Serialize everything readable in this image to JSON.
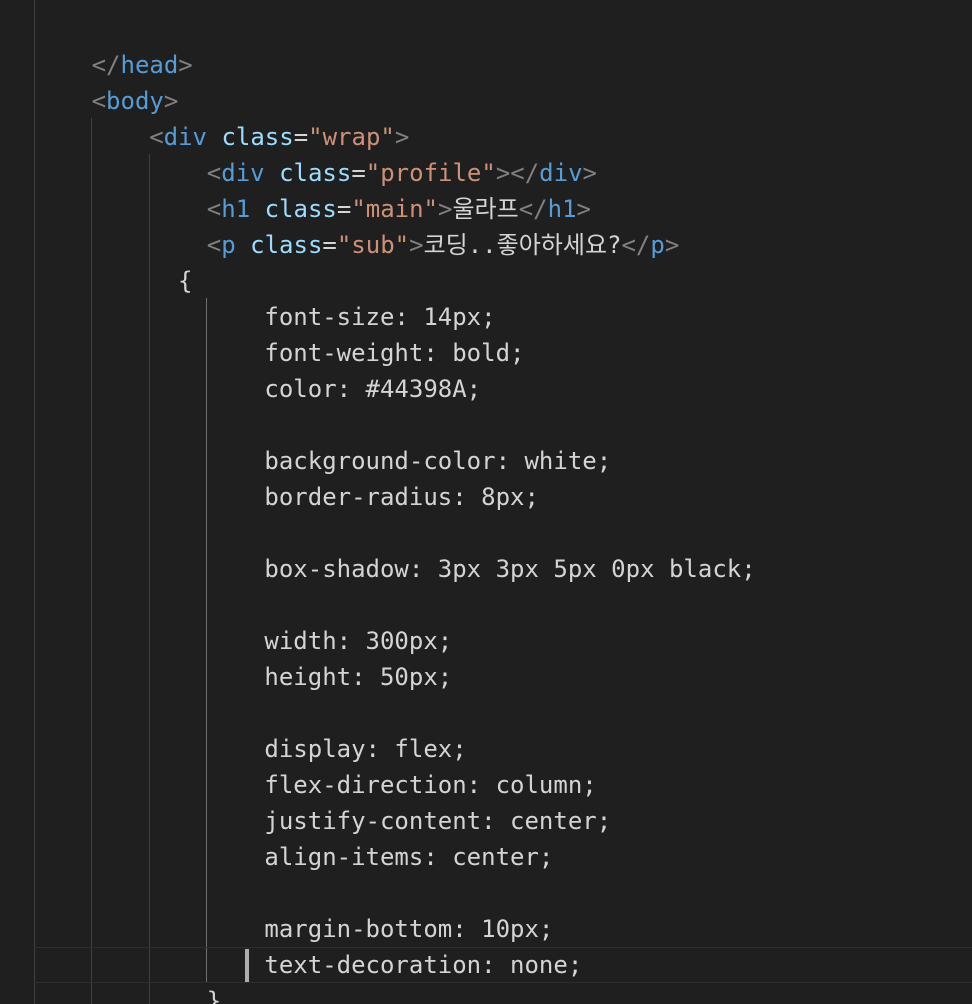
{
  "editor": {
    "lines": [
      {
        "indent": 1,
        "kind": "close",
        "tag": "head"
      },
      {
        "indent": 1,
        "kind": "open",
        "tag": "body"
      },
      {
        "indent": 2,
        "kind": "open",
        "tag": "div",
        "attr": "class",
        "value": "wrap"
      },
      {
        "indent": 3,
        "kind": "element",
        "tag": "div",
        "attr": "class",
        "value": "profile",
        "text": ""
      },
      {
        "indent": 3,
        "kind": "element",
        "tag": "h1",
        "attr": "class",
        "value": "main",
        "text": "울라프"
      },
      {
        "indent": 3,
        "kind": "element",
        "tag": "p",
        "attr": "class",
        "value": "sub",
        "text": "코딩..좋아하세요?"
      },
      {
        "indent": 2.5,
        "kind": "text",
        "text": "{"
      },
      {
        "indent": 4,
        "kind": "text",
        "text": "font-size: 14px;"
      },
      {
        "indent": 4,
        "kind": "text",
        "text": "font-weight: bold;"
      },
      {
        "indent": 4,
        "kind": "text",
        "text": "color: #44398A;"
      },
      {
        "indent": 4,
        "kind": "blank",
        "text": ""
      },
      {
        "indent": 4,
        "kind": "text",
        "text": "background-color: white;"
      },
      {
        "indent": 4,
        "kind": "text",
        "text": "border-radius: 8px;"
      },
      {
        "indent": 4,
        "kind": "blank",
        "text": ""
      },
      {
        "indent": 4,
        "kind": "text",
        "text": "box-shadow: 3px 3px 5px 0px black;"
      },
      {
        "indent": 4,
        "kind": "blank",
        "text": ""
      },
      {
        "indent": 4,
        "kind": "text",
        "text": "width: 300px;"
      },
      {
        "indent": 4,
        "kind": "text",
        "text": "height: 50px;"
      },
      {
        "indent": 4,
        "kind": "blank",
        "text": ""
      },
      {
        "indent": 4,
        "kind": "text",
        "text": "display: flex;"
      },
      {
        "indent": 4,
        "kind": "text",
        "text": "flex-direction: column;"
      },
      {
        "indent": 4,
        "kind": "text",
        "text": "justify-content: center;"
      },
      {
        "indent": 4,
        "kind": "text",
        "text": "align-items: center;"
      },
      {
        "indent": 4,
        "kind": "blank",
        "text": ""
      },
      {
        "indent": 4,
        "kind": "text",
        "text": "margin-bottom: 10px;"
      },
      {
        "indent": 4,
        "kind": "text",
        "text": "text-decoration: none;"
      },
      {
        "indent": 3,
        "kind": "text",
        "text": "}"
      }
    ]
  },
  "colors": {
    "background": "#1f1f1f",
    "tag": "#569cd6",
    "attribute": "#9cdcfe",
    "string": "#ce9178",
    "punctuation": "#808080",
    "text": "#d4d4d4"
  }
}
